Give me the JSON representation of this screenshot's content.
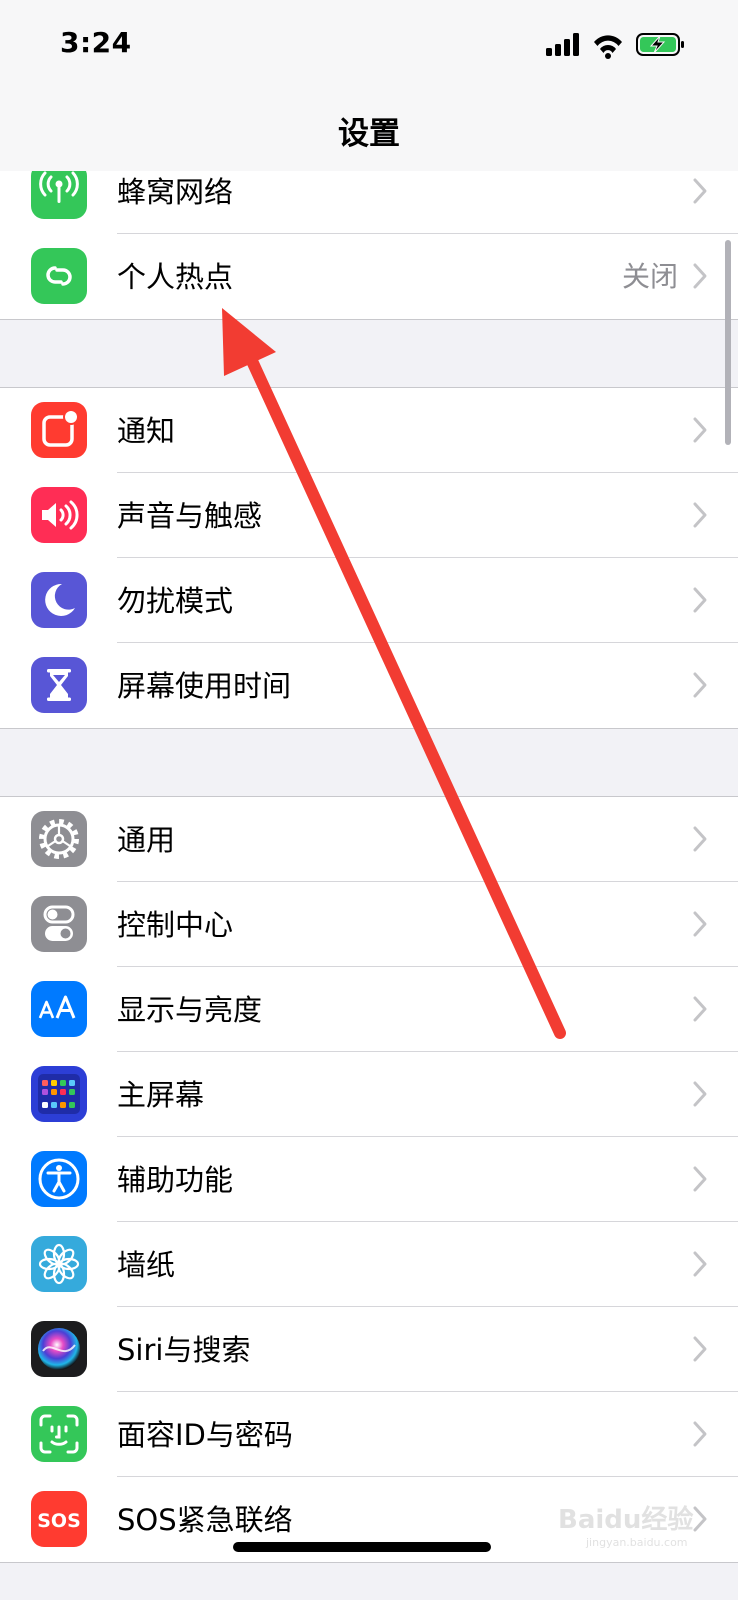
{
  "status_bar": {
    "time": "3:24"
  },
  "nav": {
    "title": "设置"
  },
  "groups": [
    [
      {
        "label": "蜂窝网络",
        "icon": "cellular-antenna-icon",
        "color": "#34c759"
      },
      {
        "label": "个人热点",
        "value": "关闭",
        "icon": "personal-hotspot-icon",
        "color": "#34c759"
      }
    ],
    [
      {
        "label": "通知",
        "icon": "notifications-icon",
        "color": "#ff3b30"
      },
      {
        "label": "声音与触感",
        "icon": "speaker-icon",
        "color": "#ff2d55"
      },
      {
        "label": "勿扰模式",
        "icon": "moon-icon",
        "color": "#5856d6"
      },
      {
        "label": "屏幕使用时间",
        "icon": "hourglass-icon",
        "color": "#5856d6"
      }
    ],
    [
      {
        "label": "通用",
        "icon": "gear-icon",
        "color": "#8e8e93"
      },
      {
        "label": "控制中心",
        "icon": "toggle-switches-icon",
        "color": "#8e8e93"
      },
      {
        "label": "显示与亮度",
        "icon": "text-size-icon",
        "color": "#007aff"
      },
      {
        "label": "主屏幕",
        "icon": "home-screen-grid-icon",
        "color": "#2c3ed6"
      },
      {
        "label": "辅助功能",
        "icon": "accessibility-person-icon",
        "color": "#007aff"
      },
      {
        "label": "墙纸",
        "icon": "flower-icon",
        "color": "#35aadc"
      },
      {
        "label": "Siri与搜索",
        "icon": "siri-orb-icon",
        "color": "#1c1c1e"
      },
      {
        "label": "面容ID与密码",
        "icon": "face-id-icon",
        "color": "#34c759"
      },
      {
        "label": "SOS紧急联络",
        "icon": "sos-icon",
        "color": "#ff3b30"
      }
    ]
  ],
  "watermark": {
    "text": "Baidu经验",
    "subtext": "jingyan.baidu.com"
  },
  "annotation": {
    "color": "#f23c32"
  }
}
